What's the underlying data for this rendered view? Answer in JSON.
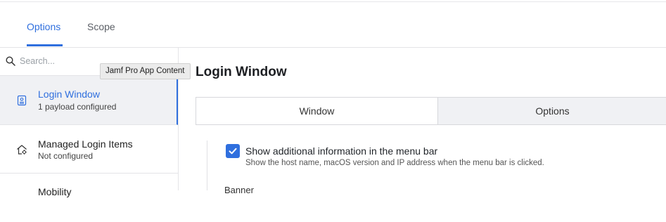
{
  "tabs": [
    {
      "label": "Options",
      "active": true
    },
    {
      "label": "Scope",
      "active": false
    }
  ],
  "sidebar": {
    "search_placeholder": "Search...",
    "items": [
      {
        "title": "Login Window",
        "status": "1 payload configured",
        "icon": "id-badge-icon",
        "selected": true
      },
      {
        "title": "Managed Login Items",
        "status": "Not configured",
        "icon": "home-gear-icon",
        "selected": false
      },
      {
        "title": "Mobility",
        "status": "",
        "icon": "",
        "selected": false
      }
    ]
  },
  "tooltip": "Jamf Pro App Content",
  "main": {
    "title": "Login Window",
    "segments": [
      {
        "label": "Window",
        "selected": true
      },
      {
        "label": "Options",
        "selected": false
      }
    ],
    "settings": {
      "show_info_label": "Show additional information in the menu bar",
      "show_info_help": "Show the host name, macOS version and IP address when the menu bar is clicked.",
      "show_info_checked": true,
      "banner_label": "Banner"
    }
  },
  "colors": {
    "accent": "#2f6fde",
    "selected_bg": "#f0f1f4",
    "border": "#e4e4e7"
  }
}
